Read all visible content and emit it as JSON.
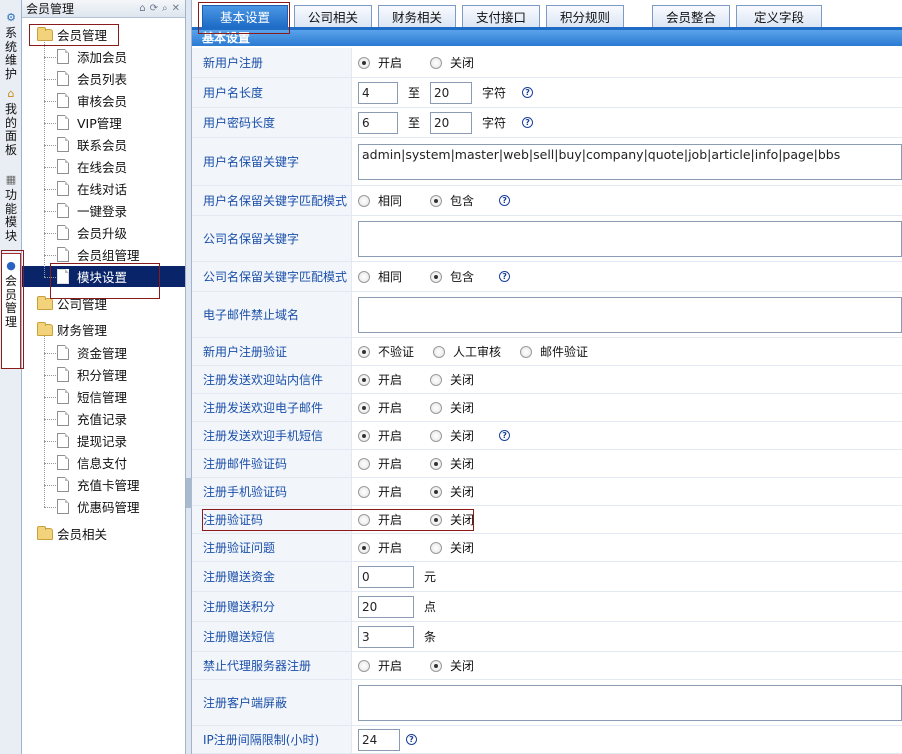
{
  "vtabs": [
    {
      "label": "系统维护",
      "icon": "system-icon",
      "active": false
    },
    {
      "label": "我的面板",
      "icon": "home-icon",
      "active": false
    },
    {
      "label": "功能模块",
      "icon": "module-icon",
      "active": false
    },
    {
      "label": "会员管理",
      "icon": "user-icon",
      "active": true
    }
  ],
  "tree": {
    "header": "会员管理",
    "header_tools": [
      "pin-icon",
      "refresh-icon",
      "search-icon",
      "close-icon"
    ],
    "root": "会员管理",
    "member_items": [
      "添加会员",
      "会员列表",
      "审核会员",
      "VIP管理",
      "联系会员",
      "在线会员",
      "在线对话",
      "一键登录",
      "会员升级",
      "会员组管理",
      "模块设置"
    ],
    "selected": "模块设置",
    "company": "公司管理",
    "finance": "财务管理",
    "finance_items": [
      "资金管理",
      "积分管理",
      "短信管理",
      "充值记录",
      "提现记录",
      "信息支付",
      "充值卡管理",
      "优惠码管理"
    ],
    "related": "会员相关"
  },
  "tabs": [
    "基本设置",
    "公司相关",
    "财务相关",
    "支付接口",
    "积分规则",
    "会员整合",
    "定义字段"
  ],
  "active_tab": "基本设置",
  "section_title": "基本设置",
  "labels": {
    "open": "开启",
    "close": "关闭",
    "same": "相同",
    "contain": "包含",
    "to": "至",
    "chars": "字符",
    "yuan": "元",
    "points": "点",
    "msgs": "条",
    "no_verify": "不验证",
    "manual": "人工审核",
    "email_verify": "邮件验证"
  },
  "fields": {
    "new_user_register": {
      "label": "新用户注册",
      "value": "开启"
    },
    "username_length": {
      "label": "用户名长度",
      "min": "4",
      "max": "20"
    },
    "password_length": {
      "label": "用户密码长度",
      "min": "6",
      "max": "20"
    },
    "reserved_keywords": {
      "label": "用户名保留关键字",
      "value": "admin|system|master|web|sell|buy|company|quote|job|article|info|page|bbs"
    },
    "reserved_match_mode": {
      "label": "用户名保留关键字匹配模式",
      "value": "包含"
    },
    "company_reserved": {
      "label": "公司名保留关键字",
      "value": ""
    },
    "company_match_mode": {
      "label": "公司名保留关键字匹配模式",
      "value": "包含"
    },
    "email_banned_domains": {
      "label": "电子邮件禁止域名",
      "value": ""
    },
    "new_user_verify": {
      "label": "新用户注册验证",
      "value": "不验证"
    },
    "welcome_message": {
      "label": "注册发送欢迎站内信件",
      "value": "开启"
    },
    "welcome_email": {
      "label": "注册发送欢迎电子邮件",
      "value": "开启"
    },
    "welcome_sms": {
      "label": "注册发送欢迎手机短信",
      "value": "开启"
    },
    "email_code": {
      "label": "注册邮件验证码",
      "value": "关闭"
    },
    "mobile_code": {
      "label": "注册手机验证码",
      "value": "关闭"
    },
    "captcha": {
      "label": "注册验证码",
      "value": "关闭"
    },
    "question": {
      "label": "注册验证问题",
      "value": "开启"
    },
    "gift_money": {
      "label": "注册赠送资金",
      "value": "0"
    },
    "gift_points": {
      "label": "注册赠送积分",
      "value": "20"
    },
    "gift_sms": {
      "label": "注册赠送短信",
      "value": "3"
    },
    "proxy_ban": {
      "label": "禁止代理服务器注册",
      "value": "关闭"
    },
    "client_block": {
      "label": "注册客户端屏蔽",
      "value": ""
    },
    "ip_interval": {
      "label": "IP注册间隔限制(小时)",
      "value": "24"
    }
  }
}
